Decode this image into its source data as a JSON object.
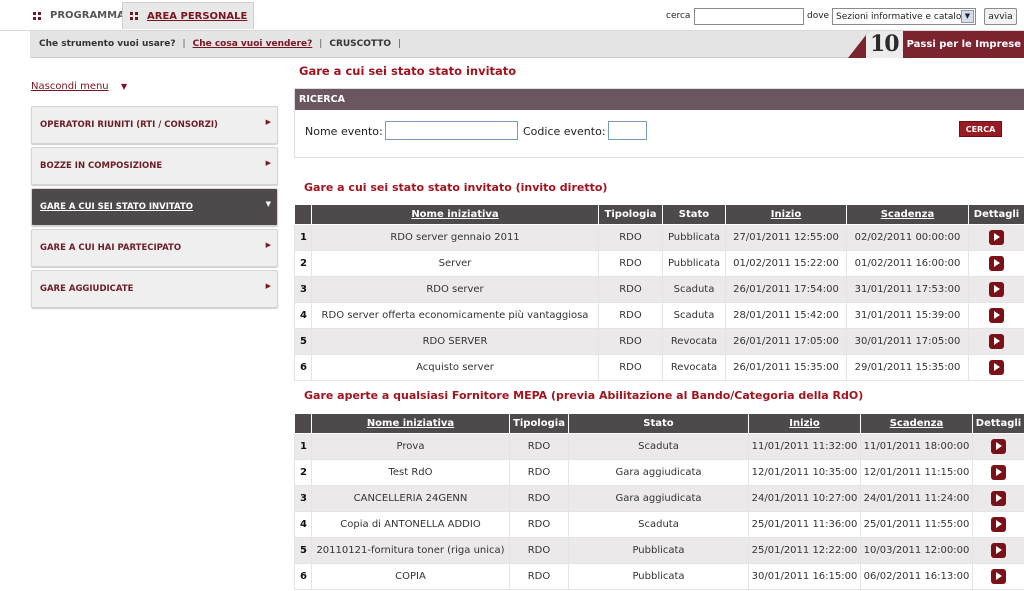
{
  "topbar": {
    "tabs": [
      {
        "label": "PROGRAMMA"
      },
      {
        "label": "AREA PERSONALE"
      }
    ],
    "search_label": "cerca",
    "search_value": "",
    "where_label": "dove",
    "where_selected": "Sezioni informative e catalogo",
    "go_label": "avvia"
  },
  "subbar": {
    "items": [
      "Che strumento vuoi usare?",
      "Che cosa vuoi vendere?",
      "CRUSCOTTO"
    ],
    "sep": "|",
    "logo_number": "10",
    "logo_text": "Passi per le Imprese"
  },
  "sidebar": {
    "hide_label": "Nascondi menu",
    "items": [
      {
        "label": "OPERATORI RIUNITI (RTI / CONSORZI)"
      },
      {
        "label": "BOZZE IN COMPOSIZIONE"
      },
      {
        "label": "GARE A CUI SEI STATO INVITATO"
      },
      {
        "label": "GARE A CUI HAI PARTECIPATO"
      },
      {
        "label": "GARE AGGIUDICATE"
      }
    ]
  },
  "main": {
    "page_title": "Gare a cui sei stato stato invitato",
    "search": {
      "header": "RICERCA",
      "nome_label": "Nome evento:",
      "nome_value": "",
      "codice_label": "Codice evento:",
      "codice_value": "",
      "button_label": "CERCA"
    },
    "table1": {
      "title": "Gare a cui sei stato stato invitato (invito diretto)",
      "headers": [
        "",
        "Nome iniziativa",
        "Tipologia",
        "Stato",
        "Inizio",
        "Scadenza",
        "Dettagli"
      ],
      "rows": [
        [
          "1",
          "RDO server gennaio 2011",
          "RDO",
          "Pubblicata",
          "27/01/2011 12:55:00",
          "02/02/2011 00:00:00"
        ],
        [
          "2",
          "Server",
          "RDO",
          "Pubblicata",
          "01/02/2011 15:22:00",
          "01/02/2011 16:00:00"
        ],
        [
          "3",
          "RDO server",
          "RDO",
          "Scaduta",
          "26/01/2011 17:54:00",
          "31/01/2011 17:53:00"
        ],
        [
          "4",
          "RDO server offerta economicamente più vantaggiosa",
          "RDO",
          "Scaduta",
          "28/01/2011 15:42:00",
          "31/01/2011 15:39:00"
        ],
        [
          "5",
          "RDO SERVER",
          "RDO",
          "Revocata",
          "26/01/2011 17:05:00",
          "30/01/2011 17:05:00"
        ],
        [
          "6",
          "Acquisto server",
          "RDO",
          "Revocata",
          "26/01/2011 15:35:00",
          "29/01/2011 15:35:00"
        ]
      ]
    },
    "table2": {
      "title": "Gare aperte a qualsiasi Fornitore MEPA (previa Abilitazione al Bando/Categoria della RdO)",
      "headers": [
        "",
        "Nome iniziativa",
        "Tipologia",
        "Stato",
        "Inizio",
        "Scadenza",
        "Dettagli"
      ],
      "rows": [
        [
          "1",
          "Prova",
          "RDO",
          "Scaduta",
          "11/01/2011 11:32:00",
          "11/01/2011 18:00:00"
        ],
        [
          "2",
          "Test RdO",
          "RDO",
          "Gara aggiudicata",
          "12/01/2011 10:35:00",
          "12/01/2011 11:15:00"
        ],
        [
          "3",
          "CANCELLERIA 24GENN",
          "RDO",
          "Gara aggiudicata",
          "24/01/2011 10:27:00",
          "24/01/2011 11:24:00"
        ],
        [
          "4",
          "Copia di ANTONELLA ADDIO",
          "RDO",
          "Scaduta",
          "25/01/2011 11:36:00",
          "25/01/2011 11:55:00"
        ],
        [
          "5",
          "20110121-fornitura toner (riga unica)",
          "RDO",
          "Pubblicata",
          "25/01/2011 12:22:00",
          "10/03/2011 12:00:00"
        ],
        [
          "6",
          "COPIA",
          "RDO",
          "Pubblicata",
          "30/01/2011 16:15:00",
          "06/02/2011 16:13:00"
        ]
      ]
    }
  }
}
